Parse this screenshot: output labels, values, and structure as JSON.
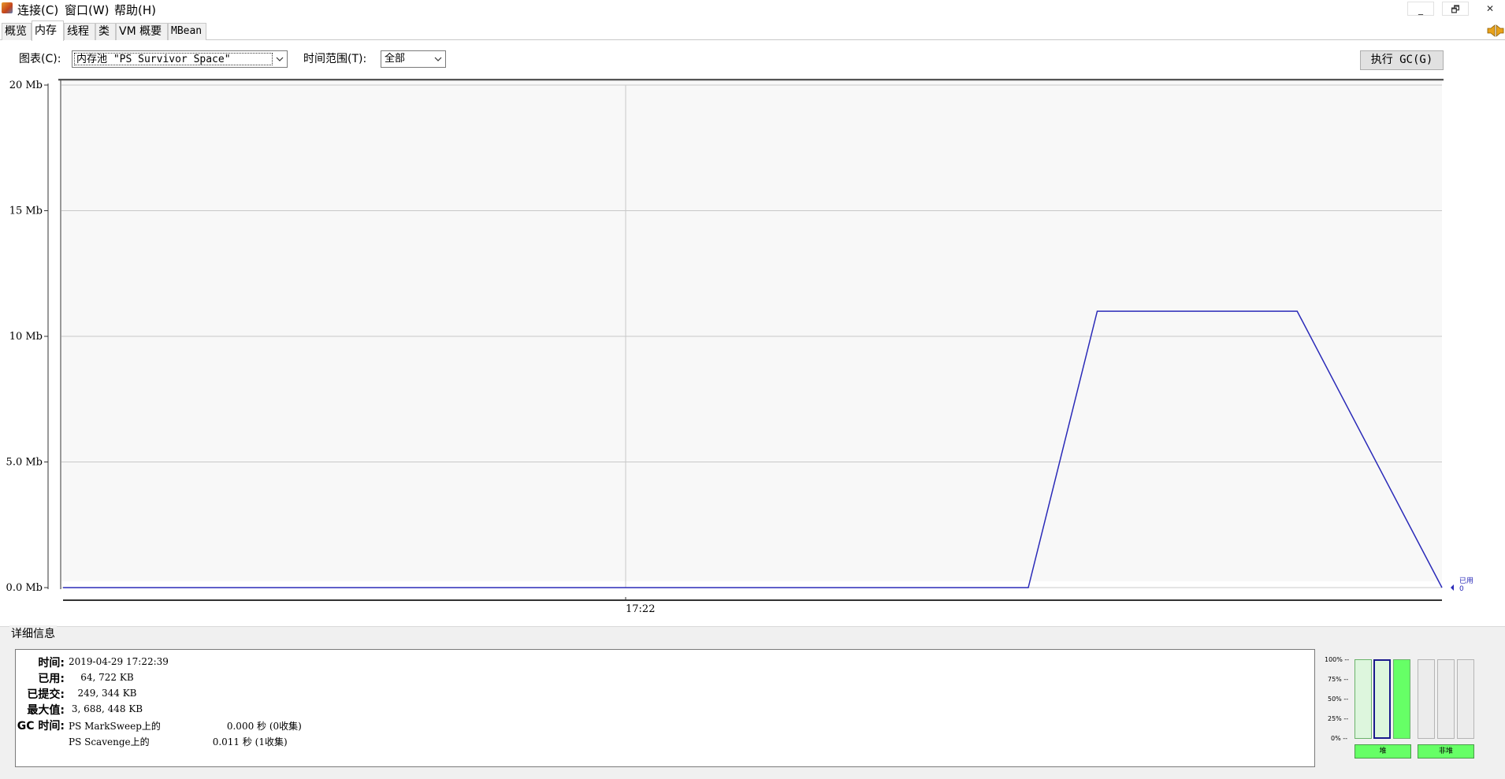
{
  "menu": {
    "items": [
      "连接(C)",
      "窗口(W)",
      "帮助(H)"
    ],
    "window_controls": [
      "_",
      "🗗",
      "✕"
    ]
  },
  "tabs": [
    {
      "label": "概览",
      "active": false
    },
    {
      "label": "内存",
      "active": true
    },
    {
      "label": "线程",
      "active": false
    },
    {
      "label": "类",
      "active": false
    },
    {
      "label": "VM 概要",
      "active": false
    },
    {
      "label": "MBean",
      "active": false
    }
  ],
  "controls": {
    "chart_label": "图表(C):",
    "chart_value": "内存池 \"PS Survivor Space\"",
    "time_range_label": "时间范围(T):",
    "time_range_value": "全部",
    "gc_button": "执行 GC(G)"
  },
  "chart_data": {
    "type": "line",
    "y_ticks": [
      "20 Mb",
      "15 Mb",
      "10 Mb",
      "5.0 Mb",
      "0.0 Mb"
    ],
    "ylim": [
      0,
      20
    ],
    "x_tick": "17:22",
    "x_tick_pos": 0.408,
    "legend": {
      "label": "已用",
      "value": "0"
    },
    "series": [
      {
        "name": "已用",
        "color": "#2a2ab8",
        "points": [
          [
            0.0,
            0
          ],
          [
            0.7,
            0
          ],
          [
            0.75,
            11
          ],
          [
            0.895,
            11
          ],
          [
            1.0,
            0
          ]
        ]
      }
    ]
  },
  "details": {
    "title": "详细信息",
    "rows": [
      {
        "label": "时间:",
        "value": "2019-04-29 17:22:39"
      },
      {
        "label": "已用:",
        "value": "    64, 722 KB"
      },
      {
        "label": "已提交:",
        "value": "   249, 344 KB"
      },
      {
        "label": "最大值:",
        "value": " 3, 688, 448 KB"
      },
      {
        "label": "GC 时间:",
        "value": "PS MarkSweep上的                      0.000 秒 (0收集)"
      },
      {
        "label": "",
        "value": "PS Scavenge上的                     0.011 秒 (1收集)"
      }
    ]
  },
  "pool_bars": {
    "pct_labels": [
      "100% --",
      "75% --",
      "50% --",
      "25% --",
      "0% --"
    ],
    "heap_label": "堆",
    "nonheap_label": "非堆",
    "heap_levels": [
      0.0,
      0.0,
      1.0
    ],
    "nonheap_levels": [
      0.0,
      0.0,
      0.0
    ],
    "colors": {
      "fill": "#66ff66",
      "selected_border": "#1a1a8c"
    }
  }
}
